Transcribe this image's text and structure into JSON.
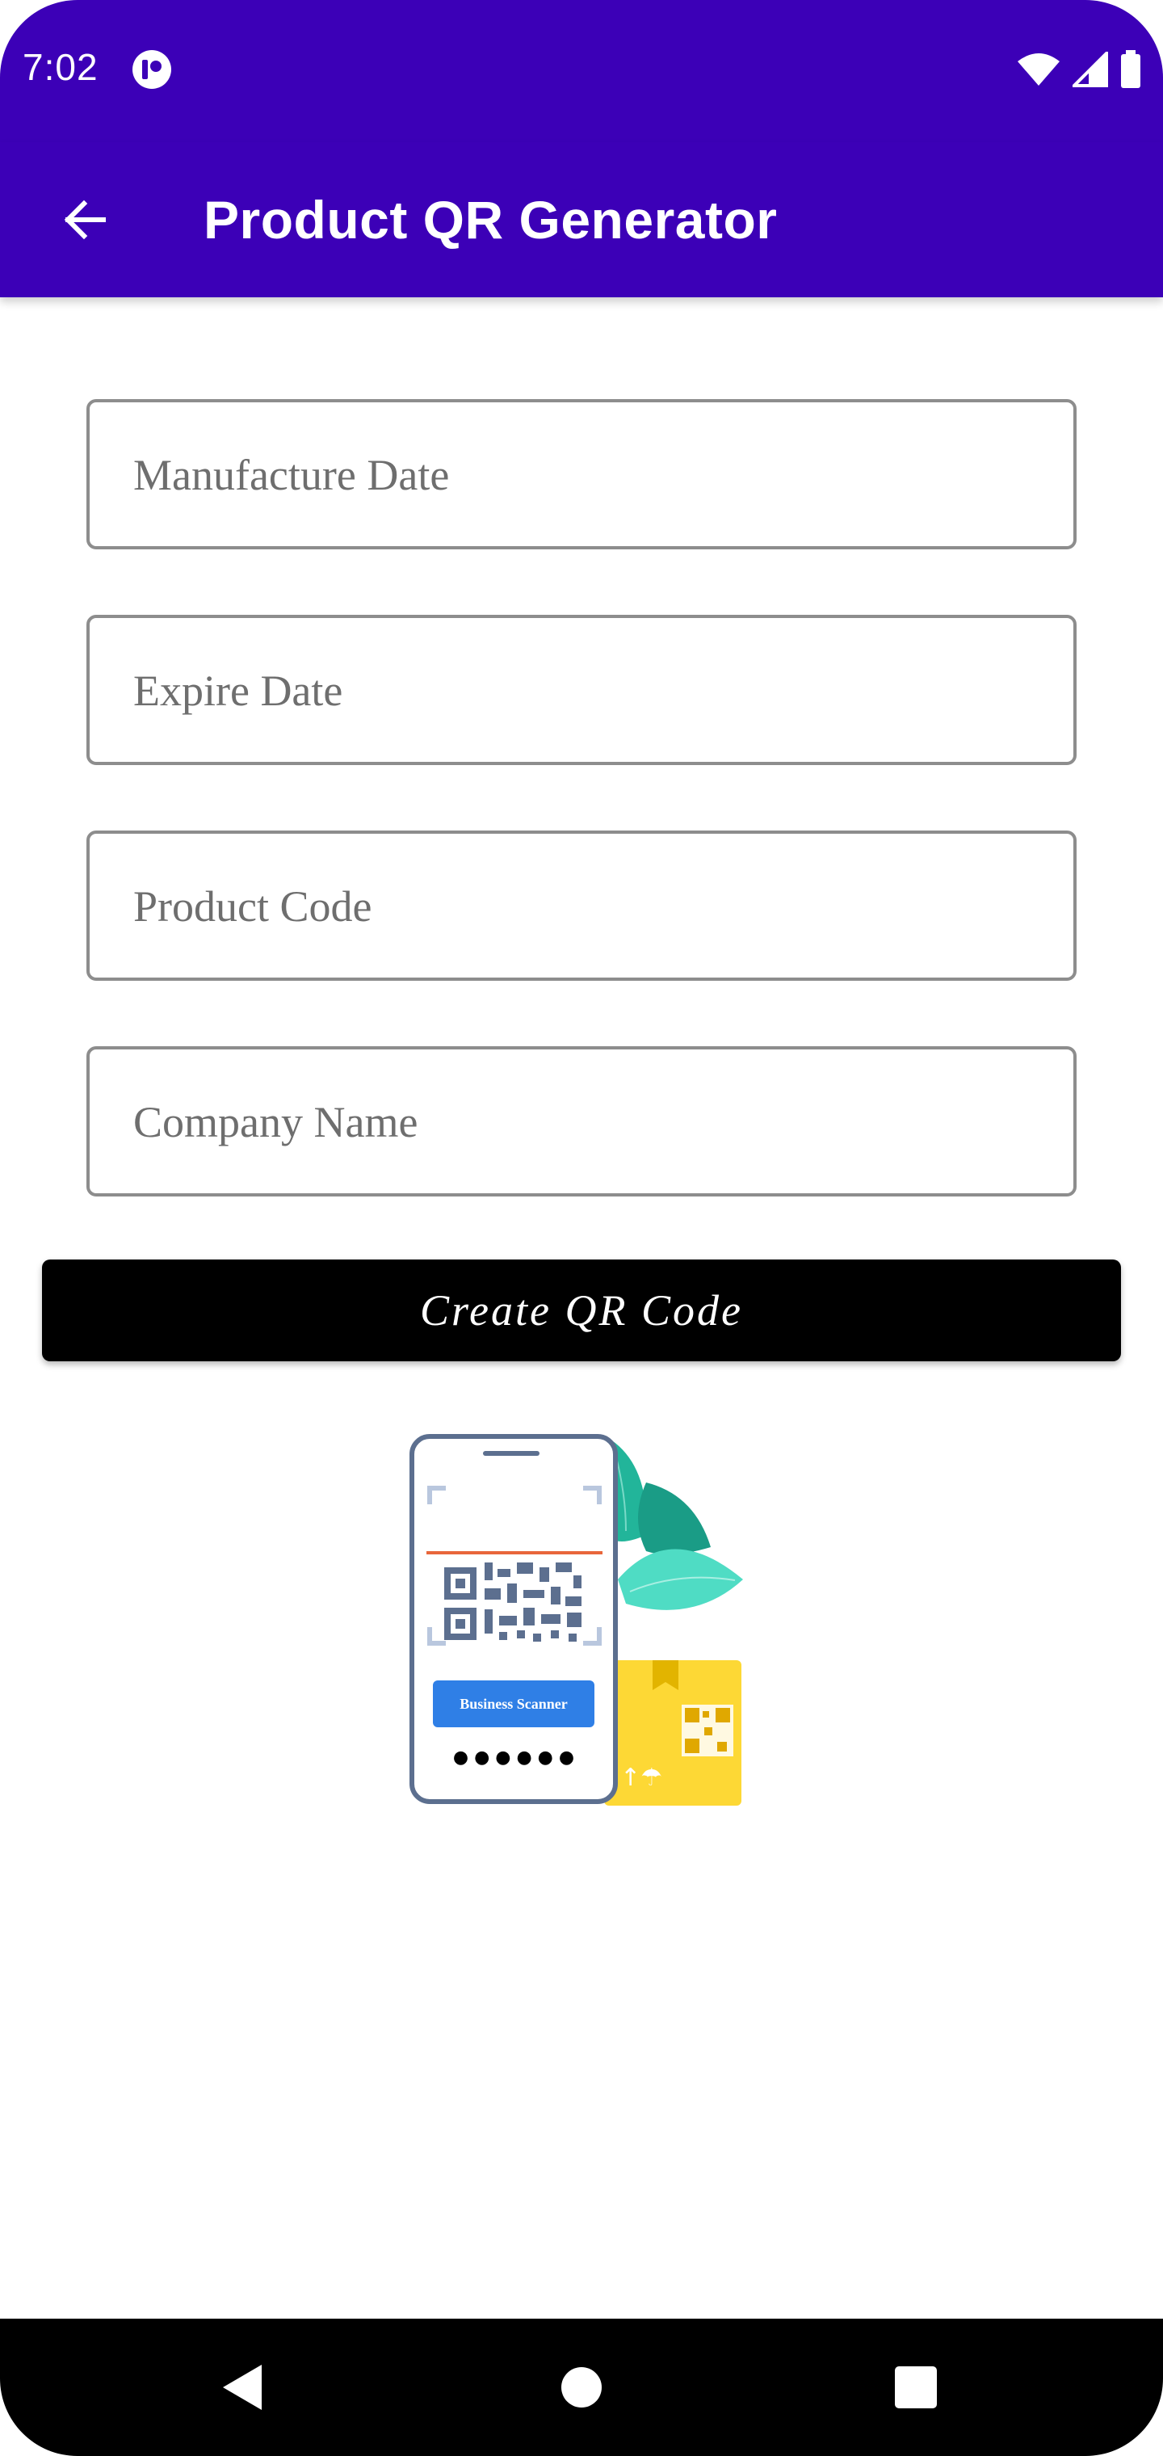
{
  "status_bar": {
    "time": "7:02",
    "icons": [
      "app-notification-icon",
      "wifi-icon",
      "cellular-signal-icon",
      "battery-icon"
    ]
  },
  "app_bar": {
    "title": "Product QR Generator",
    "back_icon": "arrow-back-icon",
    "background_color": "#3c00b7"
  },
  "form": {
    "fields": [
      {
        "placeholder": "Manufacture Date",
        "value": ""
      },
      {
        "placeholder": "Expire Date",
        "value": ""
      },
      {
        "placeholder": "Product Code",
        "value": ""
      },
      {
        "placeholder": "Company Name",
        "value": ""
      }
    ],
    "submit_label": "Create QR Code"
  },
  "illustration": {
    "scanner_button_label": "Business Scanner",
    "pin_dots": "● ● ● ● ● ●"
  },
  "nav_bar": {
    "icons": [
      "back-triangle-icon",
      "home-circle-icon",
      "recents-square-icon"
    ]
  }
}
